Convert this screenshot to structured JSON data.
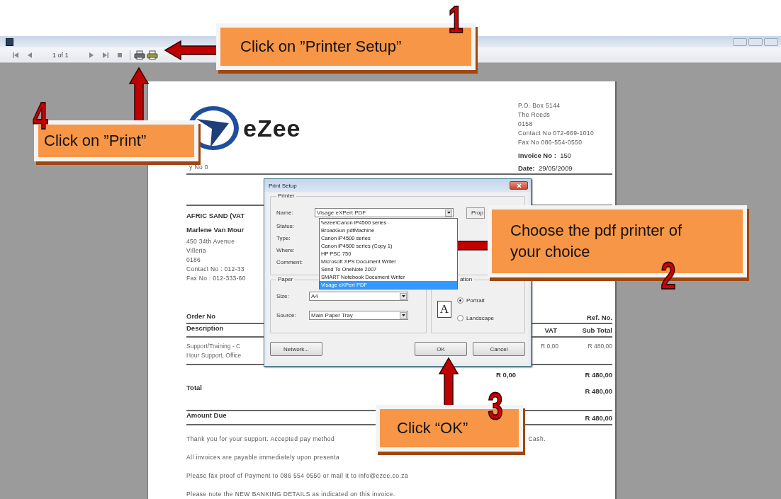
{
  "toolbar": {
    "page_indicator": "1 of 1"
  },
  "invoice": {
    "logo_text": "eZee",
    "company_lines": [
      "P.O. Box 5144",
      "The Reeds",
      "0158",
      "Contact No 072-669-1010",
      "Fax No 086-554-0550"
    ],
    "invoice_no_label": "Invoice No :",
    "invoice_no": "150",
    "date_label": "Date:",
    "date": "29/05/2009",
    "copy_no": "y No 0",
    "customer_lines": [
      {
        "text": "AFRIC SAND  (VAT",
        "bold": true
      },
      {
        "text": "Marlene Van Mour",
        "bold": true
      },
      {
        "text": "450 34th Avenue",
        "bold": false
      },
      {
        "text": "Villeria",
        "bold": false
      },
      {
        "text": "0186",
        "bold": false
      },
      {
        "text": "Contact No :  012-33",
        "bold": false
      },
      {
        "text": "Fax No :  012-333-60",
        "bold": false
      }
    ],
    "order_no_label": "Order No",
    "ref_no_label": "Ref. No.",
    "columns": [
      "Description",
      "VAT",
      "Sub Total"
    ],
    "rows": [
      {
        "description_lines": [
          "Support/Training - C",
          "Hour Support, Office"
        ],
        "vat": "R 0,00",
        "subtotal": "R 480,00"
      }
    ],
    "vat_total": "R 0,00",
    "subtotal_total": "R 480,00",
    "total_label": "Total",
    "total": "R 480,00",
    "amount_due_label": "Amount Due",
    "amount_due": "R 480,00",
    "notes": [
      {
        "text": "Thank you for your support.  Accepted pay method",
        "tail": "Cash."
      },
      {
        "text": "All invoices are payable immediately upon presenta"
      },
      {
        "text": "Please fax proof of Payment to 086 554 0550 or mail it to info@ezee.co.za"
      },
      {
        "text": "Please note the NEW BANKING DETAILS as indicated on this invoice."
      }
    ]
  },
  "dialog": {
    "title": "Print Setup",
    "printer_group": "Printer",
    "name_label": "Name:",
    "name_value": "Visage eXPert PDF",
    "properties_button": "Prop",
    "info_labels": [
      "Status:",
      "Type:",
      "Where:",
      "Comment:"
    ],
    "printer_options": [
      {
        "label": "\\\\ezee\\Canon iP4500 series",
        "selected": false
      },
      {
        "label": "BroadGun pdfMachine",
        "selected": false
      },
      {
        "label": "Canon iP4500 series",
        "selected": false
      },
      {
        "label": "Canon iP4500 series (Copy 1)",
        "selected": false
      },
      {
        "label": "HP PSC 750",
        "selected": false
      },
      {
        "label": "Microsoft XPS Document Writer",
        "selected": false
      },
      {
        "label": "Send To OneNote 2007",
        "selected": false
      },
      {
        "label": "SMART Notebook Document Writer",
        "selected": false
      },
      {
        "label": "Visage eXPert PDF",
        "selected": true
      }
    ],
    "paper_group": "Paper",
    "size_label": "Size:",
    "size_value": "A4",
    "source_label": "Source:",
    "source_value": "Main Paper Tray",
    "orientation_group": "ation",
    "orientation_icon_letter": "A",
    "orientation_options": [
      {
        "label": "Portrait",
        "selected": true
      },
      {
        "label": "Landscape",
        "selected": false
      }
    ],
    "buttons": [
      "Network...",
      "OK",
      "Cancel"
    ]
  },
  "callouts": [
    {
      "number": "1",
      "lines": [
        "Click on ”Printer Setup”"
      ]
    },
    {
      "number": "2",
      "lines": [
        "Choose the pdf printer of",
        "your choice"
      ]
    },
    {
      "number": "3",
      "lines": [
        "Click “OK”"
      ]
    },
    {
      "number": "4",
      "lines": [
        "Click on ”Print”"
      ]
    }
  ]
}
